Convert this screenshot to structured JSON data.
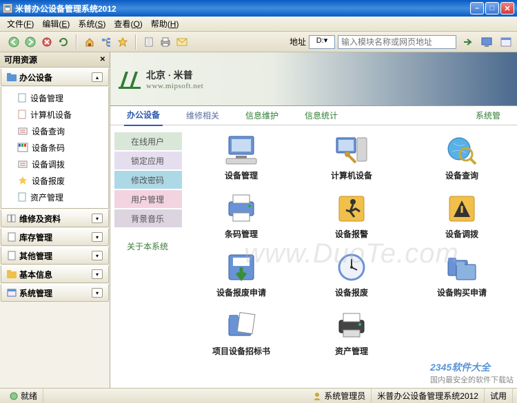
{
  "window": {
    "title": "米普办公设备管理系统2012"
  },
  "menu": {
    "file": "文件",
    "file_k": "F",
    "edit": "编辑",
    "edit_k": "E",
    "system": "系统",
    "system_k": "S",
    "query": "查看",
    "query_k": "Q",
    "help": "帮助",
    "help_k": "H"
  },
  "toolbar": {
    "address_label": "地址",
    "drive": "D:",
    "address_placeholder": "输入模块名称或网页地址"
  },
  "sidebar": {
    "header": "可用资源",
    "sections": [
      {
        "title": "办公设备",
        "expanded": true,
        "items": [
          "设备管理",
          "计算机设备",
          "设备查询",
          "设备条码",
          "设备调拨",
          "设备报废",
          "资产管理"
        ]
      },
      {
        "title": "维修及资料",
        "expanded": false
      },
      {
        "title": "库存管理",
        "expanded": false
      },
      {
        "title": "其他管理",
        "expanded": false
      },
      {
        "title": "基本信息",
        "expanded": false
      },
      {
        "title": "系统管理",
        "expanded": false
      }
    ]
  },
  "banner": {
    "brand": "北京 · 米普",
    "url": "www.mipsoft.net"
  },
  "tabs": [
    "办公设备",
    "维修相关",
    "信息维护",
    "信息统计",
    "系统管"
  ],
  "submenu": [
    "在线用户",
    "锁定应用",
    "修改密码",
    "用户管理",
    "背景音乐"
  ],
  "submenu_extra": "关于本系统",
  "grid": [
    [
      "设备管理",
      "计算机设备",
      "设备查询"
    ],
    [
      "条码管理",
      "设备报警",
      "设备调拨"
    ],
    [
      "设备报废申请",
      "设备报废",
      "设备购买申请"
    ],
    [
      "项目设备招标书",
      "资产管理"
    ]
  ],
  "watermark": "www.DuoTe.com",
  "corner": {
    "brand": "2345软件大全",
    "tag": "国内最安全的软件下载站"
  },
  "statusbar": {
    "ready": "就绪",
    "admin": "系统管理员",
    "app": "米普办公设备管理系统2012",
    "trial": "试用"
  }
}
